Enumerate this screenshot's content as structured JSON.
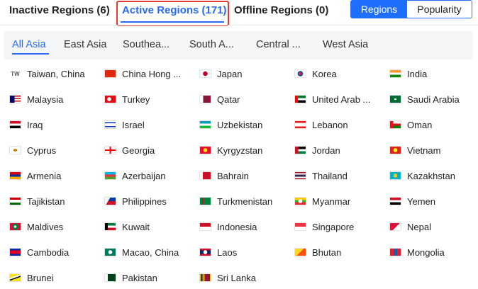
{
  "top_tabs": [
    {
      "label": "Inactive Regions (6)"
    },
    {
      "label": "Active Regions (171)"
    },
    {
      "label": "Offline Regions (0)"
    }
  ],
  "view_toggle": [
    {
      "label": "Regions"
    },
    {
      "label": "Popularity"
    }
  ],
  "sub_tabs": [
    {
      "label": "All Asia"
    },
    {
      "label": "East Asia"
    },
    {
      "label": "Southea..."
    },
    {
      "label": "South A..."
    },
    {
      "label": "Central ..."
    },
    {
      "label": "West Asia"
    }
  ],
  "colors": {
    "accent": "#2b6bf3",
    "highlight": "#e53935"
  },
  "countries": [
    {
      "name": "Taiwan, China",
      "flag": "TW",
      "icon": "taiwan-icon"
    },
    {
      "name": "China Hong ...",
      "icon": "hong-kong-flag-icon"
    },
    {
      "name": "Japan",
      "icon": "japan-flag-icon"
    },
    {
      "name": "Korea",
      "icon": "korea-flag-icon"
    },
    {
      "name": "India",
      "icon": "india-flag-icon"
    },
    {
      "name": "Malaysia",
      "icon": "malaysia-flag-icon"
    },
    {
      "name": "Turkey",
      "icon": "turkey-flag-icon"
    },
    {
      "name": "Qatar",
      "icon": "qatar-flag-icon"
    },
    {
      "name": "United Arab ...",
      "icon": "uae-flag-icon"
    },
    {
      "name": "Saudi Arabia",
      "icon": "saudi-arabia-flag-icon"
    },
    {
      "name": "Iraq",
      "icon": "iraq-flag-icon"
    },
    {
      "name": "Israel",
      "icon": "israel-flag-icon"
    },
    {
      "name": "Uzbekistan",
      "icon": "uzbekistan-flag-icon"
    },
    {
      "name": "Lebanon",
      "icon": "lebanon-flag-icon"
    },
    {
      "name": "Oman",
      "icon": "oman-flag-icon"
    },
    {
      "name": "Cyprus",
      "icon": "cyprus-flag-icon"
    },
    {
      "name": "Georgia",
      "icon": "georgia-flag-icon"
    },
    {
      "name": "Kyrgyzstan",
      "icon": "kyrgyzstan-flag-icon"
    },
    {
      "name": "Jordan",
      "icon": "jordan-flag-icon"
    },
    {
      "name": "Vietnam",
      "icon": "vietnam-flag-icon"
    },
    {
      "name": "Armenia",
      "icon": "armenia-flag-icon"
    },
    {
      "name": "Azerbaijan",
      "icon": "azerbaijan-flag-icon"
    },
    {
      "name": "Bahrain",
      "icon": "bahrain-flag-icon"
    },
    {
      "name": "Thailand",
      "icon": "thailand-flag-icon"
    },
    {
      "name": "Kazakhstan",
      "icon": "kazakhstan-flag-icon"
    },
    {
      "name": "Tajikistan",
      "icon": "tajikistan-flag-icon"
    },
    {
      "name": "Philippines",
      "icon": "philippines-flag-icon"
    },
    {
      "name": "Turkmenistan",
      "icon": "turkmenistan-flag-icon"
    },
    {
      "name": "Myanmar",
      "icon": "myanmar-flag-icon"
    },
    {
      "name": "Yemen",
      "icon": "yemen-flag-icon"
    },
    {
      "name": "Maldives",
      "icon": "maldives-flag-icon"
    },
    {
      "name": "Kuwait",
      "icon": "kuwait-flag-icon"
    },
    {
      "name": "Indonesia",
      "icon": "indonesia-flag-icon"
    },
    {
      "name": "Singapore",
      "icon": "singapore-flag-icon"
    },
    {
      "name": "Nepal",
      "icon": "nepal-flag-icon"
    },
    {
      "name": "Cambodia",
      "icon": "cambodia-flag-icon"
    },
    {
      "name": "Macao, China",
      "icon": "macao-flag-icon"
    },
    {
      "name": "Laos",
      "icon": "laos-flag-icon"
    },
    {
      "name": "Bhutan",
      "icon": "bhutan-flag-icon"
    },
    {
      "name": "Mongolia",
      "icon": "mongolia-flag-icon"
    },
    {
      "name": "Brunei",
      "icon": "brunei-flag-icon"
    },
    {
      "name": "Pakistan",
      "icon": "pakistan-flag-icon"
    },
    {
      "name": "Sri Lanka",
      "icon": "sri-lanka-flag-icon"
    }
  ]
}
